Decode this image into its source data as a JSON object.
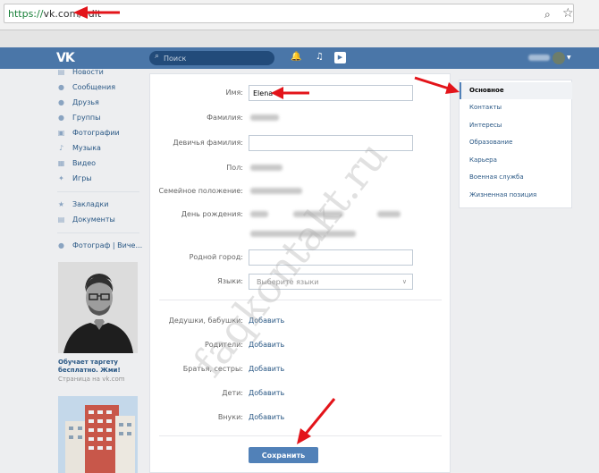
{
  "browser": {
    "url_scheme": "https://",
    "url_rest": "vk.com/edit",
    "zoom_icon": "magnifier-icon",
    "star_icon": "star-icon"
  },
  "header": {
    "logo": "VK",
    "search_placeholder": "Поиск",
    "accent": "#4a76a8"
  },
  "left_menu": [
    {
      "label": "Новости",
      "icon": "newspaper-icon"
    },
    {
      "label": "Сообщения",
      "icon": "message-icon"
    },
    {
      "label": "Друзья",
      "icon": "user-icon"
    },
    {
      "label": "Группы",
      "icon": "group-icon"
    },
    {
      "label": "Фотографии",
      "icon": "camera-icon"
    },
    {
      "label": "Музыка",
      "icon": "music-icon"
    },
    {
      "label": "Видео",
      "icon": "film-icon"
    },
    {
      "label": "Игры",
      "icon": "game-icon"
    },
    {
      "label": "Закладки",
      "icon": "star-icon"
    },
    {
      "label": "Документы",
      "icon": "document-icon"
    },
    {
      "label": "Фотограф | Виче...",
      "icon": "group-icon"
    }
  ],
  "promo": {
    "title": "Обучает таргету бесплатно. Жми!",
    "subtitle": "Страница на vk.com"
  },
  "form": {
    "name_label": "Имя:",
    "name_value": "Elena",
    "surname_label": "Фамилия:",
    "maiden_label": "Девичья фамилия:",
    "sex_label": "Пол:",
    "family_label": "Семейное положение:",
    "birthday_label": "День рождения:",
    "hometown_label": "Родной город:",
    "languages_label": "Языки:",
    "languages_placeholder": "Выберите языки",
    "grandparents_label": "Дедушки, бабушки:",
    "parents_label": "Родители:",
    "siblings_label": "Братья, сестры:",
    "children_label": "Дети:",
    "grandchildren_label": "Внуки:",
    "add_label": "Добавить",
    "save_label": "Сохранить"
  },
  "right_nav": [
    {
      "label": "Основное",
      "active": true
    },
    {
      "label": "Контакты",
      "active": false
    },
    {
      "label": "Интересы",
      "active": false
    },
    {
      "label": "Образование",
      "active": false
    },
    {
      "label": "Карьера",
      "active": false
    },
    {
      "label": "Военная служба",
      "active": false
    },
    {
      "label": "Жизненная позиция",
      "active": false
    }
  ],
  "watermark": "faqkontakt.ru",
  "arrow_color": "#e3141a"
}
